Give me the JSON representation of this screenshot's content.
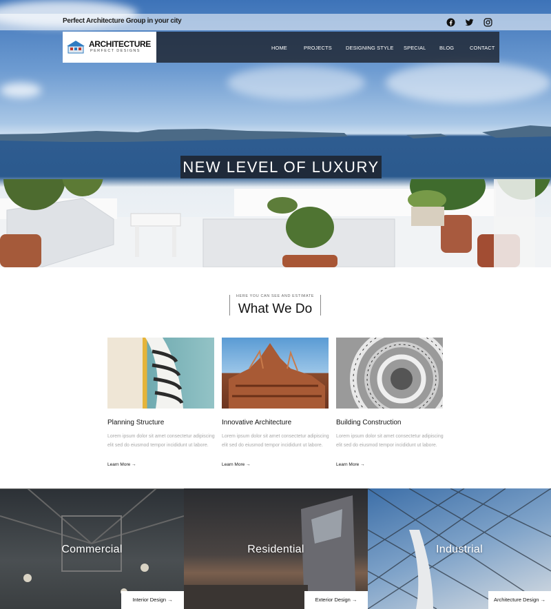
{
  "topbar": {
    "tagline": "Perfect Architecture Group in your city"
  },
  "social": [
    {
      "icon": "facebook-icon"
    },
    {
      "icon": "twitter-icon"
    },
    {
      "icon": "instagram-icon"
    }
  ],
  "logo": {
    "title": "ARCHITECTURE",
    "subtitle": "PERFECT DESIGNS"
  },
  "nav": [
    "HOME",
    "PROJECTS",
    "DESIGNING STYLE",
    "SPECIAL",
    "BLOG",
    "CONTACT"
  ],
  "hero": {
    "headline": "NEW LEVEL OF LUXURY"
  },
  "what_we_do": {
    "kicker": "HERE YOU CAN SEE AND ESTIMATE",
    "title": "What We Do",
    "cards": [
      {
        "title": "Planning Structure",
        "body": "Lorem ipsum dolor sit amet consectetur adipiscing elit sed do eiusmod tempor incididunt ut labore.",
        "link": "Learn More →"
      },
      {
        "title": "Innovative Architecture",
        "body": "Lorem ipsum dolor sit amet consectetur adipiscing elit sed do eiusmod tempor incididunt ut labore.",
        "link": "Learn More →"
      },
      {
        "title": "Building Construction",
        "body": "Lorem ipsum dolor sit amet consectetur adipiscing elit sed do eiusmod tempor incididunt ut labore.",
        "link": "Learn More →"
      }
    ]
  },
  "panels": [
    {
      "title": "Commercial",
      "button": "Interior Design →"
    },
    {
      "title": "Residential",
      "button": "Exterior Design →"
    },
    {
      "title": "Industrial",
      "button": "Architecture Design →"
    }
  ],
  "colors": {
    "nav_bg": "#1e2430",
    "headline_bg": "#1f2a3a",
    "body_text": "#a8a8a8"
  }
}
